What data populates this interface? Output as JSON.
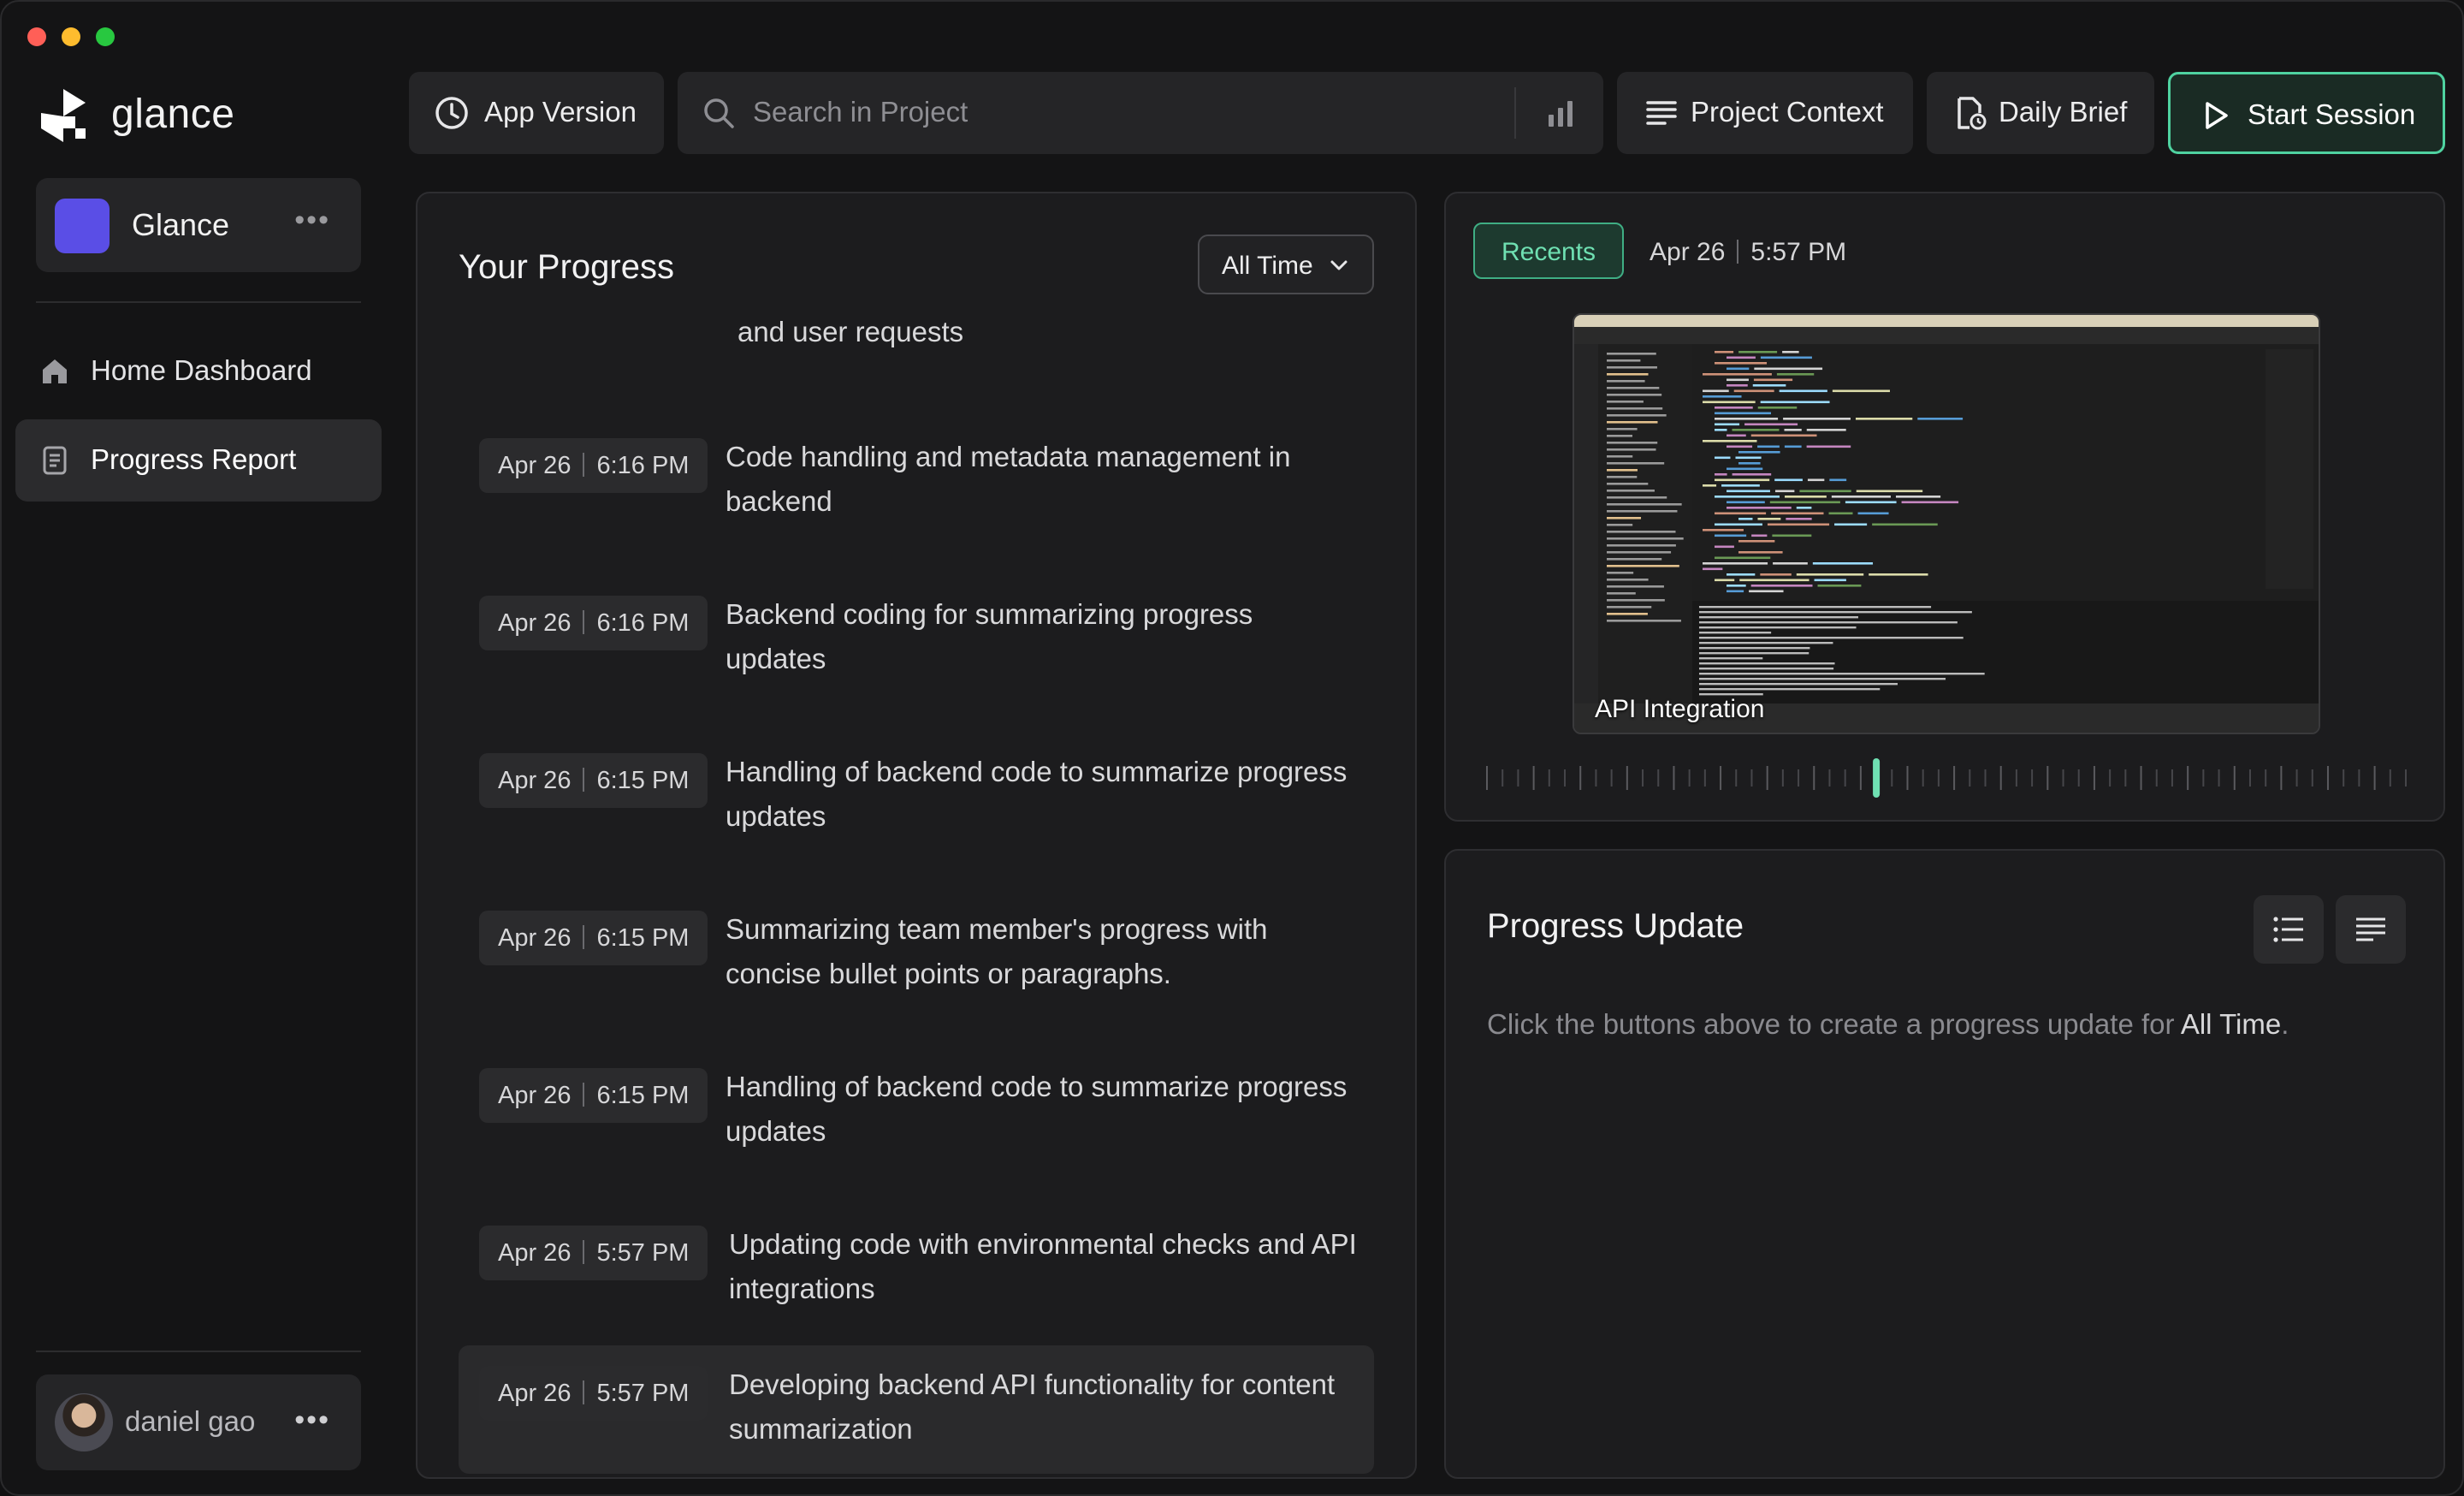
{
  "app": {
    "name": "glance"
  },
  "workspace": {
    "name": "Glance"
  },
  "sidebar": {
    "items": [
      {
        "label": "Home Dashboard",
        "icon": "home-icon"
      },
      {
        "label": "Progress Report",
        "icon": "document-icon",
        "active": true
      }
    ]
  },
  "user": {
    "name": "daniel gao"
  },
  "toolbar": {
    "app_version": "App Version",
    "search_placeholder": "Search in Project",
    "project_context": "Project Context",
    "daily_brief": "Daily Brief",
    "start_session": "Start Session"
  },
  "progress": {
    "title": "Your Progress",
    "filter": "All Time",
    "partial_text": "and user requests",
    "entries": [
      {
        "date": "Apr 26",
        "time": "6:16 PM",
        "text": "Code handling and metadata management in backend"
      },
      {
        "date": "Apr 26",
        "time": "6:16 PM",
        "text": "Backend coding for summarizing progress updates"
      },
      {
        "date": "Apr 26",
        "time": "6:15 PM",
        "text": "Handling of backend code to summarize progress updates"
      },
      {
        "date": "Apr 26",
        "time": "6:15 PM",
        "text": "Summarizing team member's progress with concise bullet points or paragraphs."
      },
      {
        "date": "Apr 26",
        "time": "6:15 PM",
        "text": "Handling of backend code to summarize progress updates"
      },
      {
        "date": "Apr 26",
        "time": "5:57 PM",
        "text": "Updating code with environmental checks and API integrations"
      },
      {
        "date": "Apr 26",
        "time": "5:57 PM",
        "text": "Developing backend API functionality for content summarization",
        "highlighted": true
      }
    ]
  },
  "recents": {
    "tab": "Recents",
    "date": "Apr 26",
    "time": "5:57 PM",
    "caption": "API Integration",
    "timeline_selected_fraction": 0.43
  },
  "progress_update": {
    "title": "Progress Update",
    "hint_prefix": "Click the buttons above to create a progress update for ",
    "hint_strong": "All Time",
    "hint_suffix": "."
  },
  "colors": {
    "accent": "#4fd2a0",
    "workspace": "#5a4ee6",
    "background": "#141415"
  }
}
